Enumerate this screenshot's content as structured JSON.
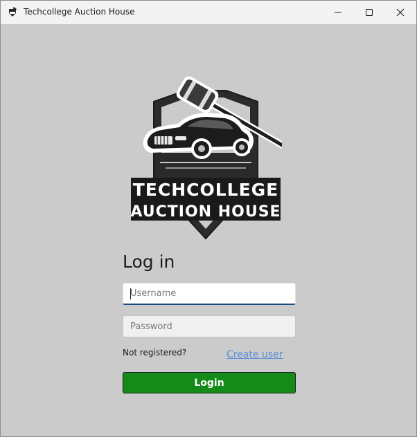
{
  "window": {
    "title": "Techcollege Auction House",
    "app_icon": "gavel-car-icon",
    "controls": {
      "minimize": "minimize-icon",
      "maximize": "maximize-icon",
      "close": "close-icon"
    }
  },
  "logo": {
    "line1": "TECHCOLLEGE",
    "line2": "AUCTION HOUSE"
  },
  "login": {
    "heading": "Log in",
    "username_placeholder": "Username",
    "username_value": "",
    "password_placeholder": "Password",
    "password_value": "",
    "not_registered": "Not registered?",
    "create_user_link": "Create user",
    "submit_label": "Login"
  },
  "colors": {
    "background": "#cbcbcb",
    "titlebar": "#f3f3f3",
    "login_button": "#148a18",
    "link": "#5b8fd8",
    "focus_underline": "#1e4a8a"
  }
}
